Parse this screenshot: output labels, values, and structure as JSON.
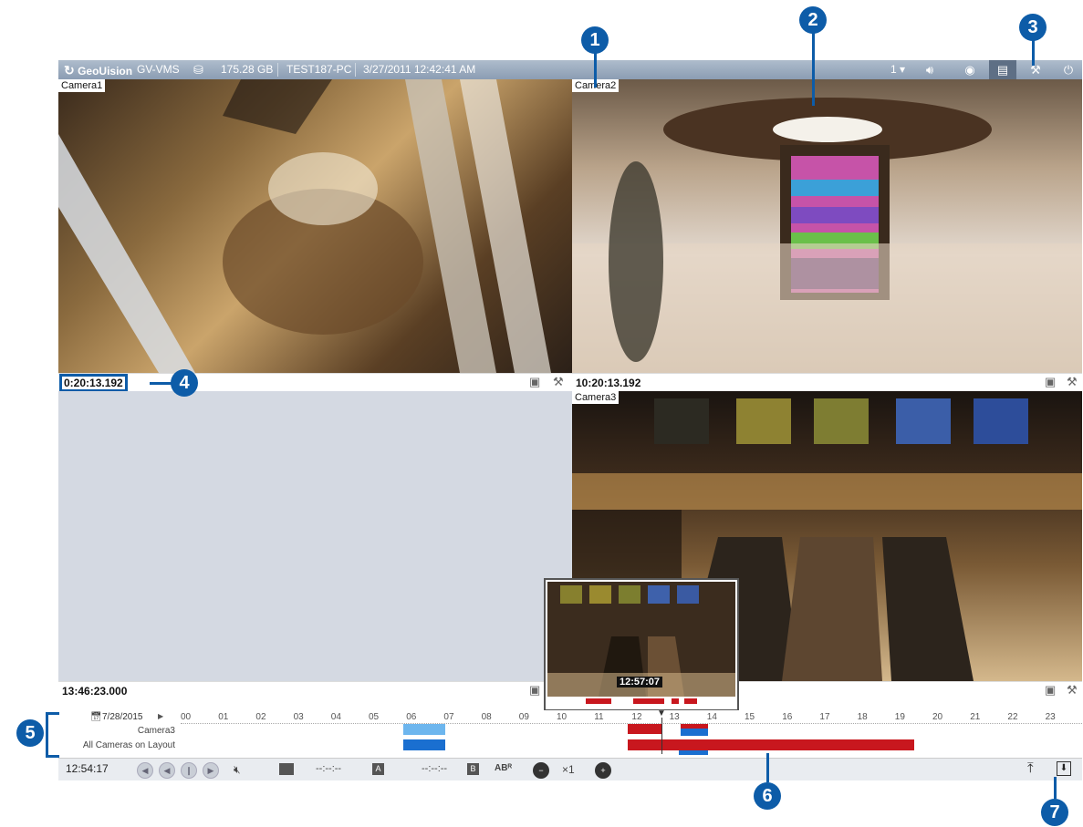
{
  "topbar": {
    "brand": "GeoUision",
    "product": "GV-VMS",
    "storage": "175.28 GB",
    "pc_name": "TEST187-PC",
    "datetime": "3/27/2011 12:42:41 AM",
    "layout_num": "1"
  },
  "panes": {
    "cam1": {
      "label": "Camera1",
      "timestamp": "0:20:13.192"
    },
    "cam2": {
      "label": "Camera2",
      "timestamp": "10:20:13.192"
    },
    "empty": {
      "timestamp": "13:46:23.000"
    },
    "cam3": {
      "label": "Camera3"
    }
  },
  "preview": {
    "time": "12:57:07"
  },
  "timeline": {
    "date": "7/28/2015",
    "hours": [
      "00",
      "01",
      "02",
      "03",
      "04",
      "05",
      "06",
      "07",
      "08",
      "09",
      "10",
      "11",
      "12",
      "13",
      "14",
      "15",
      "16",
      "17",
      "18",
      "19",
      "20",
      "21",
      "22",
      "23"
    ],
    "rows": [
      "Camera3",
      "All Cameras on Layout"
    ]
  },
  "controls": {
    "current_time": "12:54:17",
    "start_mark": "--:--:--",
    "end_mark": "--:--:--",
    "speed": "×1"
  },
  "callouts": [
    "1",
    "2",
    "3",
    "4",
    "5",
    "6",
    "7"
  ],
  "colors": {
    "accent": "#0d5ca8",
    "record": "#c8171e",
    "event": "#1a6fd0"
  }
}
